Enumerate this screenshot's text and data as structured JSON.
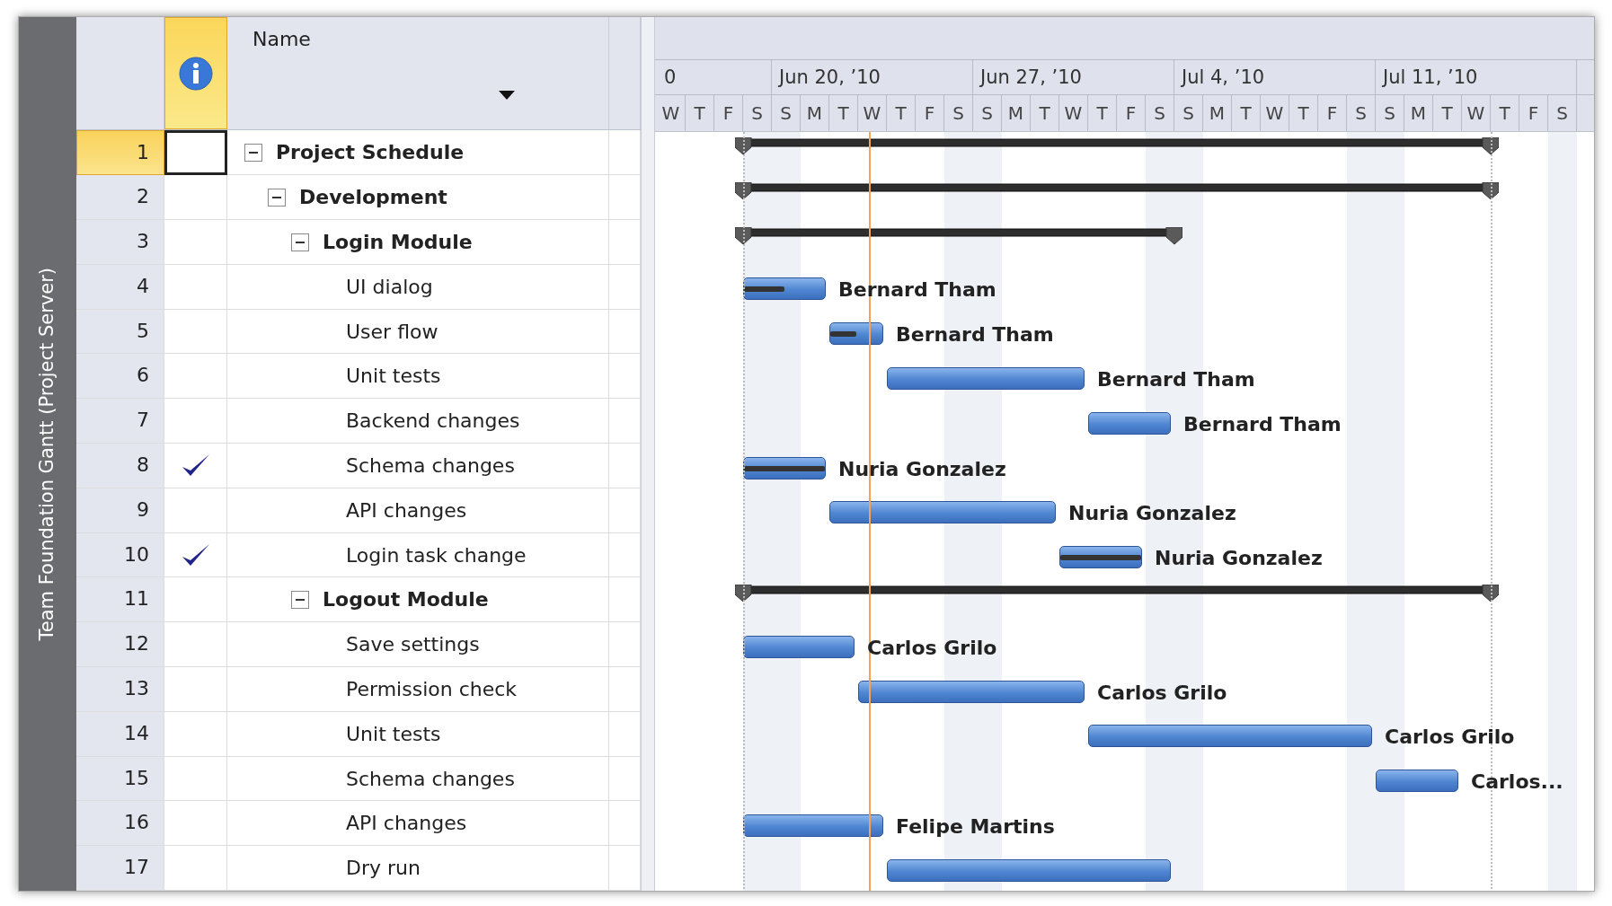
{
  "side_label": "Team Foundation Gantt (Project Server)",
  "columns": {
    "name": "Name"
  },
  "timescale": {
    "weeks": [
      {
        "label": "0",
        "days": [
          "W",
          "T",
          "F",
          "S"
        ]
      },
      {
        "label": "Jun 20, ’10",
        "days": [
          "S",
          "M",
          "T",
          "W",
          "T",
          "F",
          "S"
        ]
      },
      {
        "label": "Jun 27, ’10",
        "days": [
          "S",
          "M",
          "T",
          "W",
          "T",
          "F",
          "S"
        ]
      },
      {
        "label": "Jul 4, ’10",
        "days": [
          "S",
          "M",
          "T",
          "W",
          "T",
          "F",
          "S"
        ]
      },
      {
        "label": "Jul 11, ’10",
        "days": [
          "S",
          "M",
          "T",
          "W",
          "T",
          "F",
          "S"
        ]
      }
    ]
  },
  "tasks": [
    {
      "id": "1",
      "name": "Project Schedule",
      "kind": "summary",
      "expanded": true,
      "selected": true,
      "complete": false,
      "children": [
        {
          "id": "2",
          "name": "Development",
          "kind": "summary",
          "expanded": true,
          "selected": false,
          "complete": false,
          "children": [
            {
              "id": "3",
              "name": "Login Module",
              "kind": "summary",
              "expanded": true,
              "selected": false,
              "complete": false,
              "children": [
                {
                  "id": "4",
                  "name": "UI dialog",
                  "kind": "task",
                  "selected": false,
                  "complete": false,
                  "level": 0.5,
                  "resource": "Bernard Tham"
                },
                {
                  "id": "5",
                  "name": "User flow",
                  "kind": "task",
                  "selected": false,
                  "complete": false,
                  "level": 0.5,
                  "resource": "Bernard Tham"
                },
                {
                  "id": "6",
                  "name": "Unit tests",
                  "kind": "task",
                  "selected": false,
                  "complete": false,
                  "resource": "Bernard Tham"
                },
                {
                  "id": "7",
                  "name": "Backend changes",
                  "kind": "task",
                  "selected": false,
                  "complete": false,
                  "resource": "Bernard Tham"
                },
                {
                  "id": "8",
                  "name": "Schema changes",
                  "kind": "task",
                  "selected": false,
                  "complete": true,
                  "level": 1,
                  "resource": "Nuria Gonzalez"
                },
                {
                  "id": "9",
                  "name": "API changes",
                  "kind": "task",
                  "selected": false,
                  "complete": false,
                  "resource": "Nuria Gonzalez"
                },
                {
                  "id": "10",
                  "name": "Login task change",
                  "kind": "task",
                  "selected": false,
                  "complete": true,
                  "level": 1,
                  "resource": "Nuria Gonzalez"
                }
              ]
            },
            {
              "id": "11",
              "name": "Logout Module",
              "kind": "summary",
              "expanded": true,
              "selected": false,
              "complete": false,
              "children": [
                {
                  "id": "12",
                  "name": "Save settings",
                  "kind": "task",
                  "selected": false,
                  "complete": false,
                  "resource": "Carlos Grilo"
                },
                {
                  "id": "13",
                  "name": "Permission check",
                  "kind": "task",
                  "selected": false,
                  "complete": false,
                  "resource": "Carlos Grilo"
                },
                {
                  "id": "14",
                  "name": "Unit tests",
                  "kind": "task",
                  "selected": false,
                  "complete": false,
                  "resource": "Carlos Grilo"
                },
                {
                  "id": "15",
                  "name": "Schema changes",
                  "kind": "task",
                  "selected": false,
                  "complete": false,
                  "resource": "Carlos..."
                },
                {
                  "id": "16",
                  "name": "API changes",
                  "kind": "task",
                  "selected": false,
                  "complete": false,
                  "resource": "Felipe Martins"
                },
                {
                  "id": "17",
                  "name": "Dry run",
                  "kind": "task",
                  "selected": false,
                  "complete": false
                }
              ]
            }
          ]
        }
      ]
    }
  ]
}
